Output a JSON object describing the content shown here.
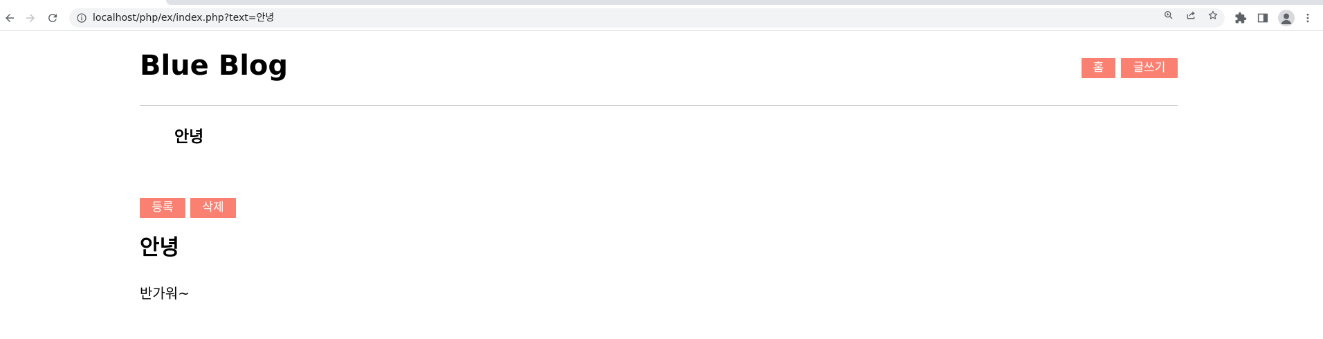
{
  "browser": {
    "url": "localhost/php/ex/index.php?text=안녕",
    "icons": {
      "back": "back-arrow-icon",
      "forward": "forward-arrow-icon",
      "reload": "reload-icon",
      "site_info": "info-icon",
      "zoom": "zoom-icon",
      "share": "share-icon",
      "bookmark": "star-icon",
      "extensions": "puzzle-icon",
      "side_panel": "side-panel-icon",
      "profile": "avatar",
      "menu": "kebab-menu-icon"
    }
  },
  "header": {
    "title": "Blue Blog",
    "home_label": "홈",
    "write_label": "글쓰기"
  },
  "post_list": {
    "items": [
      {
        "title": "안녕"
      }
    ]
  },
  "actions": {
    "register_label": "등록",
    "delete_label": "삭제"
  },
  "post": {
    "title": "안녕",
    "body": "반가워~"
  },
  "colors": {
    "button_bg": "#fa8072",
    "button_text": "#ffffff",
    "divider": "#d0d0d0",
    "omnibox_bg": "#f1f3f4"
  }
}
